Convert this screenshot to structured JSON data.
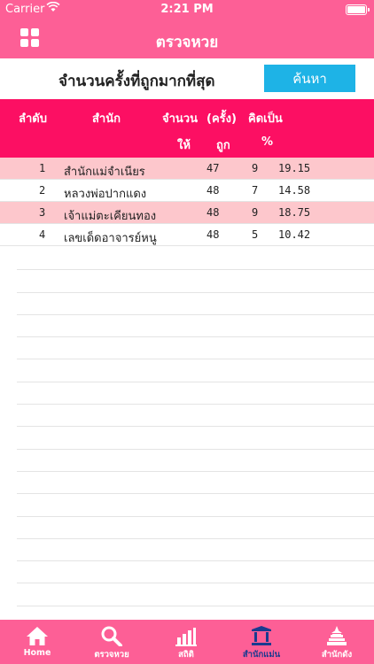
{
  "status": {
    "carrier": "Carrier",
    "time": "2:21 PM"
  },
  "nav": {
    "title": "ตรวจหวย",
    "menu_icon": "grid-icon"
  },
  "search": {
    "label": "จำนวนครั้งที่ถูกมากที่สุด",
    "button": "ค้นหา"
  },
  "table": {
    "headers": {
      "rank": "ลำดับ",
      "office": "สำนัก",
      "amount_top": "จำนวน",
      "amount_bottom": "ให้",
      "times_top": "(ครั้ง)",
      "times_bottom": "ถูก",
      "percent_top": "คิดเป็น",
      "percent_bottom": "%"
    },
    "rows": [
      {
        "rank": "1",
        "office": "สำนักแม่จำเนียร",
        "given": "47",
        "correct": "9",
        "percent": "19.15"
      },
      {
        "rank": "2",
        "office": "หลวงพ่อปากแดง",
        "given": "48",
        "correct": "7",
        "percent": "14.58"
      },
      {
        "rank": "3",
        "office": "เจ้าแม่ตะเคียนทอง",
        "given": "48",
        "correct": "9",
        "percent": "18.75"
      },
      {
        "rank": "4",
        "office": "เลขเด็ดอาจารย์หนู",
        "given": "48",
        "correct": "5",
        "percent": "10.42"
      }
    ]
  },
  "tabs": [
    {
      "label": "Home",
      "icon": "home-icon"
    },
    {
      "label": "ตรวจหวย",
      "icon": "search-icon"
    },
    {
      "label": "สถิติ",
      "icon": "bar-chart-icon"
    },
    {
      "label": "สำนักแม่น",
      "icon": "temple-icon",
      "active": true
    },
    {
      "label": "สำนักดัง",
      "icon": "shrine-icon"
    }
  ],
  "colors": {
    "header_pink": "#fd5f96",
    "table_header": "#fc0f63",
    "row_highlight": "#fdc7cc",
    "search_button": "#1eb3e6",
    "active_tab": "#1b3a8f"
  }
}
